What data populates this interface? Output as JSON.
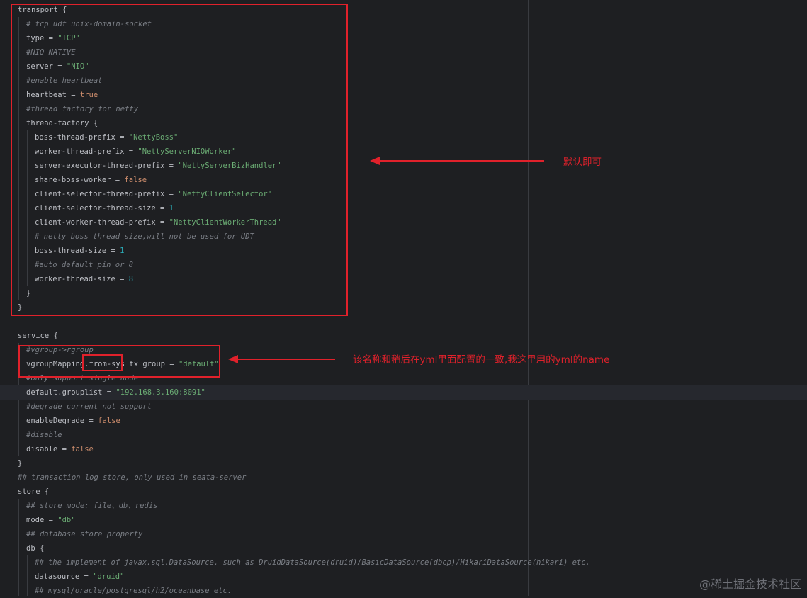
{
  "code": {
    "transport_header": "transport {",
    "comment_tcp": "# tcp udt unix-domain-socket",
    "type_key": "type",
    "type_value": "\"TCP\"",
    "comment_nio_native": "#NIO NATIVE",
    "server_key": "server",
    "server_value": "\"NIO\"",
    "comment_enable_heartbeat": "#enable heartbeat",
    "heartbeat_key": "heartbeat",
    "heartbeat_value": "true",
    "comment_thread_factory": "#thread factory for netty",
    "thread_factory_header": "thread-factory {",
    "boss_thread_prefix_key": "boss-thread-prefix",
    "boss_thread_prefix_value": "\"NettyBoss\"",
    "worker_thread_prefix_key": "worker-thread-prefix",
    "worker_thread_prefix_value": "\"NettyServerNIOWorker\"",
    "server_executor_thread_prefix_key": "server-executor-thread-prefix",
    "server_executor_thread_prefix_value": "\"NettyServerBizHandler\"",
    "share_boss_worker_key": "share-boss-worker",
    "share_boss_worker_value": "false",
    "client_selector_thread_prefix_key": "client-selector-thread-prefix",
    "client_selector_thread_prefix_value": "\"NettyClientSelector\"",
    "client_selector_thread_size_key": "client-selector-thread-size",
    "client_selector_thread_size_value": "1",
    "client_worker_thread_prefix_key": "client-worker-thread-prefix",
    "client_worker_thread_prefix_value": "\"NettyClientWorkerThread\"",
    "comment_boss_thread_size": "# netty boss thread size,will not be used for UDT",
    "boss_thread_size_key": "boss-thread-size",
    "boss_thread_size_value": "1",
    "comment_auto_default": "#auto default pin or 8",
    "worker_thread_size_key": "worker-thread-size",
    "worker_thread_size_value": "8",
    "close_brace": "}",
    "service_header": "service {",
    "comment_vgroup": "#vgroup->rgroup",
    "vgroup_mapping_key": "vgroupMapping.from-sys_tx_group",
    "vgroup_mapping_value": "\"default\"",
    "comment_only_support": "#only support single node",
    "default_grouplist_key": "default.grouplist",
    "default_grouplist_value": "\"192.168.3.160:8091\"",
    "comment_degrade": "#degrade current not support",
    "enable_degrade_key": "enableDegrade",
    "enable_degrade_value": "false",
    "comment_disable": "#disable",
    "disable_key": "disable",
    "disable_value": "false",
    "comment_transaction_log": "## transaction log store, only used in seata-server",
    "store_header": "store {",
    "comment_store_mode": "## store mode: file、db、redis",
    "mode_key": "mode",
    "mode_value": "\"db\"",
    "comment_database_store": "## database store property",
    "db_header": "db {",
    "comment_implement": "## the implement of javax.sql.DataSource, such as DruidDataSource(druid)/BasicDataSource(dbcp)/HikariDataSource(hikari) etc.",
    "datasource_key": "datasource",
    "datasource_value": "\"druid\"",
    "comment_mysql": "## mysql/oracle/postgresql/h2/oceanbase etc.",
    "equals": " = "
  },
  "annotations": {
    "default_ok": "默认即可",
    "name_note": "该名称和稍后在yml里面配置的一致,我这里用的yml的name"
  },
  "watermark": "@稀土掘金技术社区",
  "colors": {
    "background": "#1e1f22",
    "string": "#6aab73",
    "keyword": "#cf8e6d",
    "number": "#2aacb8",
    "comment": "#7a7e85",
    "annotation_red": "#e0212b"
  }
}
